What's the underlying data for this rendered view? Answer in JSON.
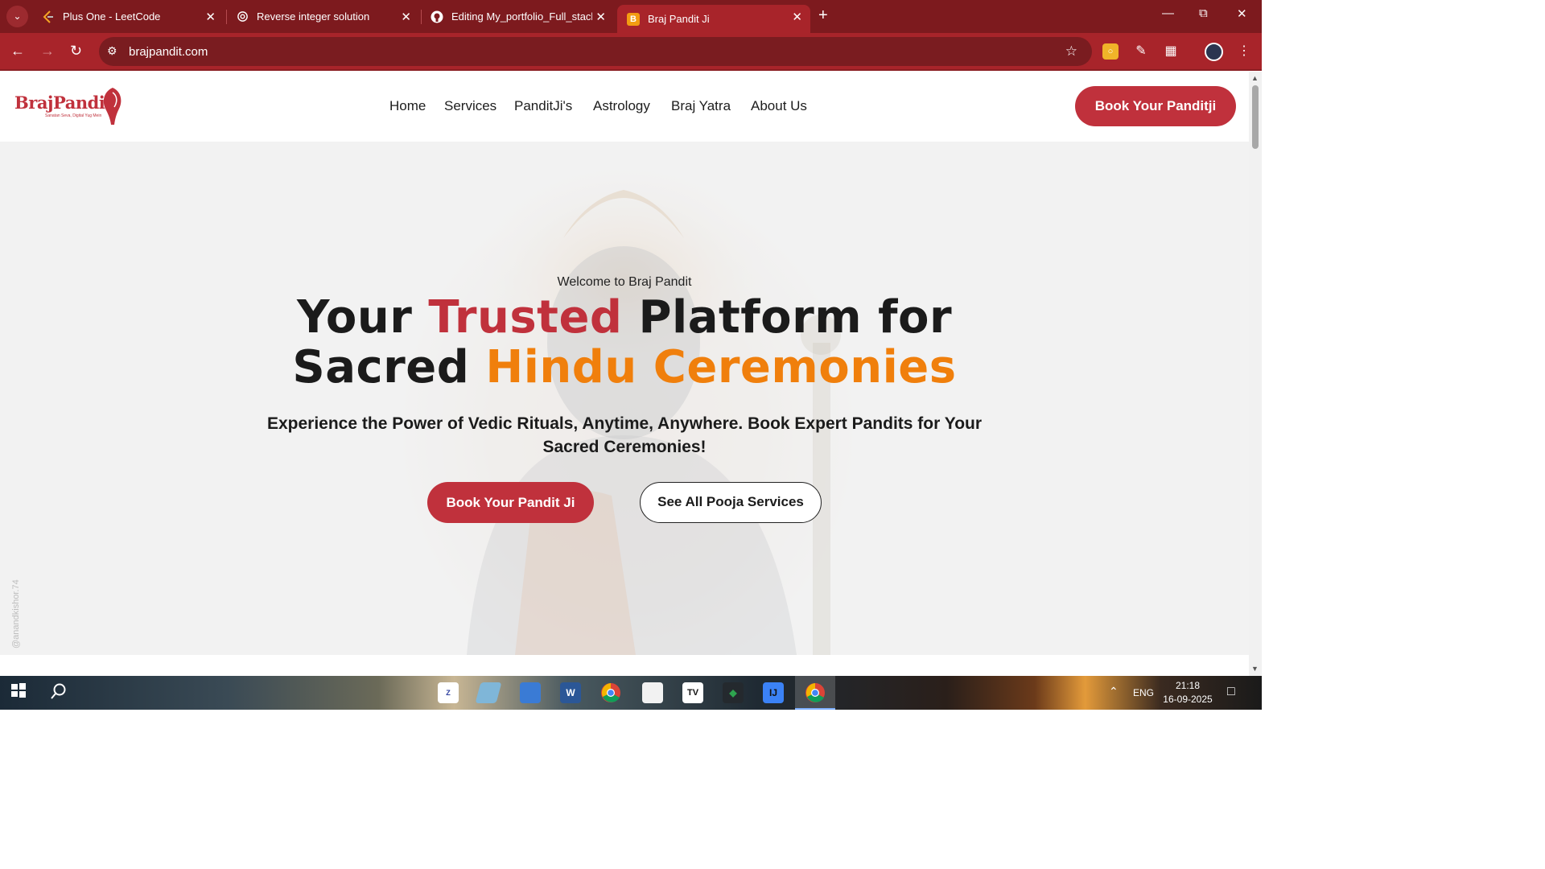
{
  "browser": {
    "tabs": [
      {
        "title": "Plus One - LeetCode",
        "icon": "leetcode-icon"
      },
      {
        "title": "Reverse integer solution",
        "icon": "chatgpt-icon"
      },
      {
        "title": "Editing My_portfolio_Full_stack/",
        "icon": "github-icon"
      },
      {
        "title": "Braj Pandit Ji",
        "icon": "brajpandit-favicon",
        "active": true,
        "favicon_letter": "B"
      }
    ],
    "url": "brajpandit.com"
  },
  "site": {
    "logo_text": "BrajPandit",
    "logo_tagline": "Sanatan Seva, Digital Yug Mein",
    "nav": [
      "Home",
      "Services",
      "PanditJi's",
      "Astrology",
      "Braj Yatra",
      "About Us"
    ],
    "header_cta": "Book Your Panditji",
    "colors": {
      "brand_red": "#c0313c",
      "accent_orange": "#f07f0c",
      "chrome": "#a8242a"
    }
  },
  "hero": {
    "welcome": "Welcome to Braj Pandit",
    "headline": {
      "part1": "Your ",
      "highlight1": "Trusted",
      "part2": " Platform for",
      "part3": "Sacred ",
      "highlight2": "Hindu Ceremonies"
    },
    "subline": "Experience the Power of Vedic Rituals, Anytime, Anywhere. Book Expert Pandits for Your Sacred Ceremonies!",
    "primary_button": "Book Your Pandit Ji",
    "secondary_button": "See All Pooja Services",
    "watermark": "@anandkishor.74"
  },
  "taskbar": {
    "language": "ENG",
    "time": "21:18",
    "date": "16-09-2025"
  }
}
